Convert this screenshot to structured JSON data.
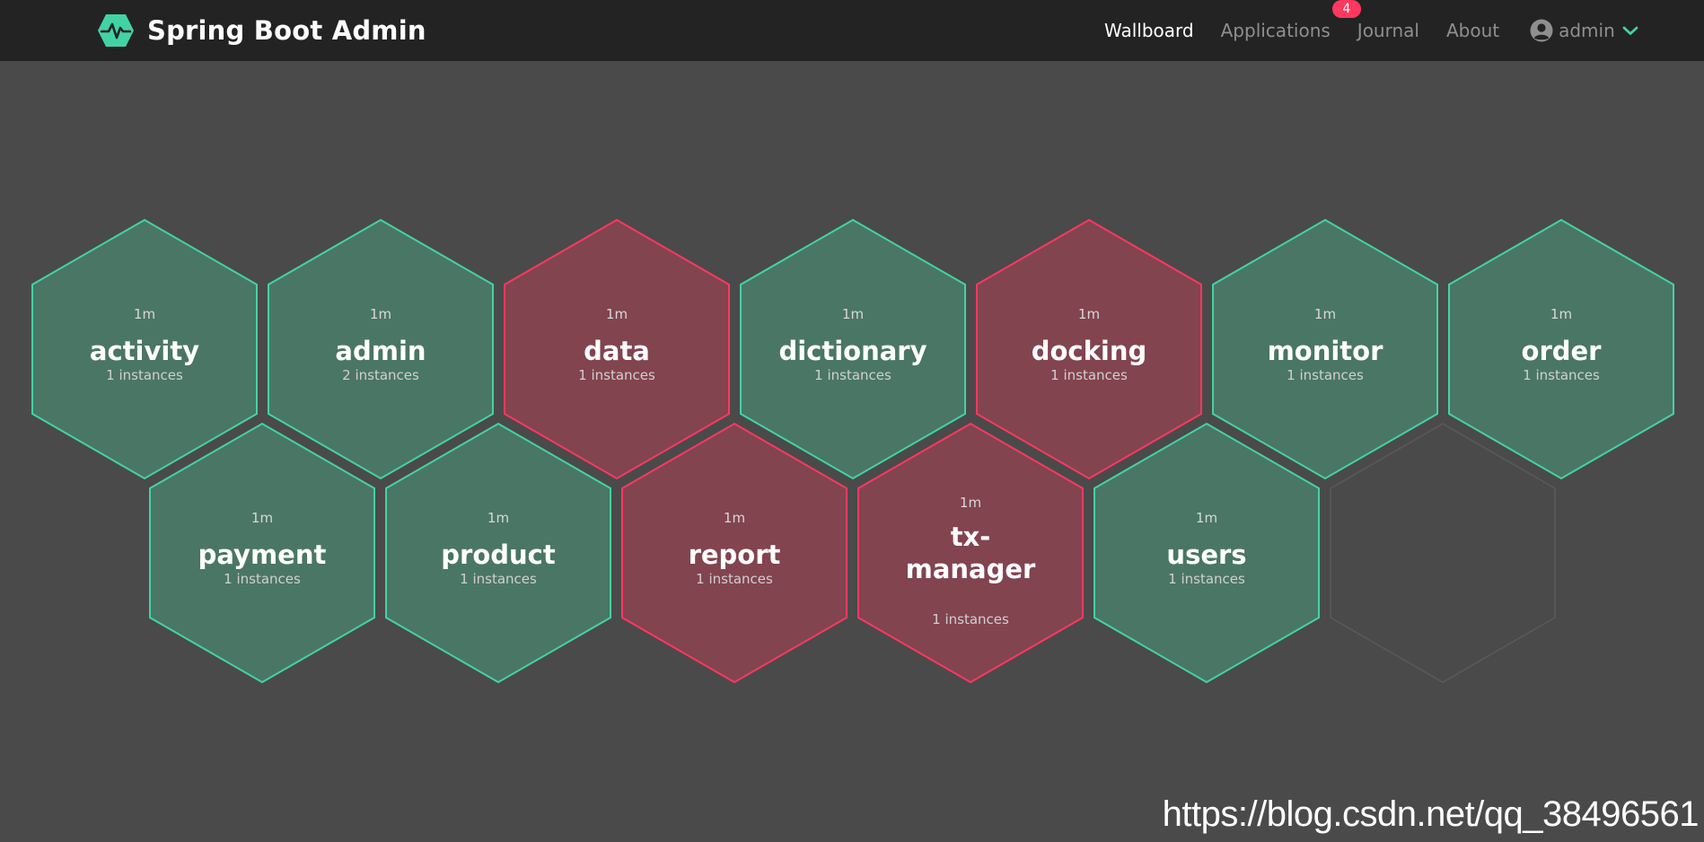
{
  "app": {
    "title": "Spring Boot Admin",
    "logo_icon": "heartbeat-hexagon-icon",
    "accent_color": "#42d3a5"
  },
  "nav": {
    "items": [
      {
        "label": "Wallboard",
        "active": true
      },
      {
        "label": "Applications",
        "badge": "4"
      },
      {
        "label": "Journal"
      },
      {
        "label": "About"
      }
    ],
    "user": {
      "name": "admin",
      "icon": "user-circle-icon",
      "caret_icon": "chevron-down-icon"
    }
  },
  "colors": {
    "up_fill": "#4a7665",
    "up_stroke": "#42d3a5",
    "down_fill": "#82444f",
    "down_stroke": "#ff3860",
    "empty_stroke": "#5a5a5a"
  },
  "applications": [
    {
      "name": "activity",
      "age": "1m",
      "instances": "1 instances",
      "status": "UP"
    },
    {
      "name": "admin",
      "age": "1m",
      "instances": "2 instances",
      "status": "UP"
    },
    {
      "name": "data",
      "age": "1m",
      "instances": "1 instances",
      "status": "DOWN"
    },
    {
      "name": "dictionary",
      "age": "1m",
      "instances": "1 instances",
      "status": "UP"
    },
    {
      "name": "docking",
      "age": "1m",
      "instances": "1 instances",
      "status": "DOWN"
    },
    {
      "name": "monitor",
      "age": "1m",
      "instances": "1 instances",
      "status": "UP"
    },
    {
      "name": "order",
      "age": "1m",
      "instances": "1 instances",
      "status": "UP"
    },
    {
      "name": "payment",
      "age": "1m",
      "instances": "1 instances",
      "status": "UP"
    },
    {
      "name": "product",
      "age": "1m",
      "instances": "1 instances",
      "status": "UP"
    },
    {
      "name": "report",
      "age": "1m",
      "instances": "1 instances",
      "status": "DOWN"
    },
    {
      "name": "tx-manager",
      "age": "1m",
      "instances": "1 instances",
      "status": "DOWN"
    },
    {
      "name": "users",
      "age": "1m",
      "instances": "1 instances",
      "status": "UP"
    }
  ],
  "watermark": "https://blog.csdn.net/qq_38496561"
}
